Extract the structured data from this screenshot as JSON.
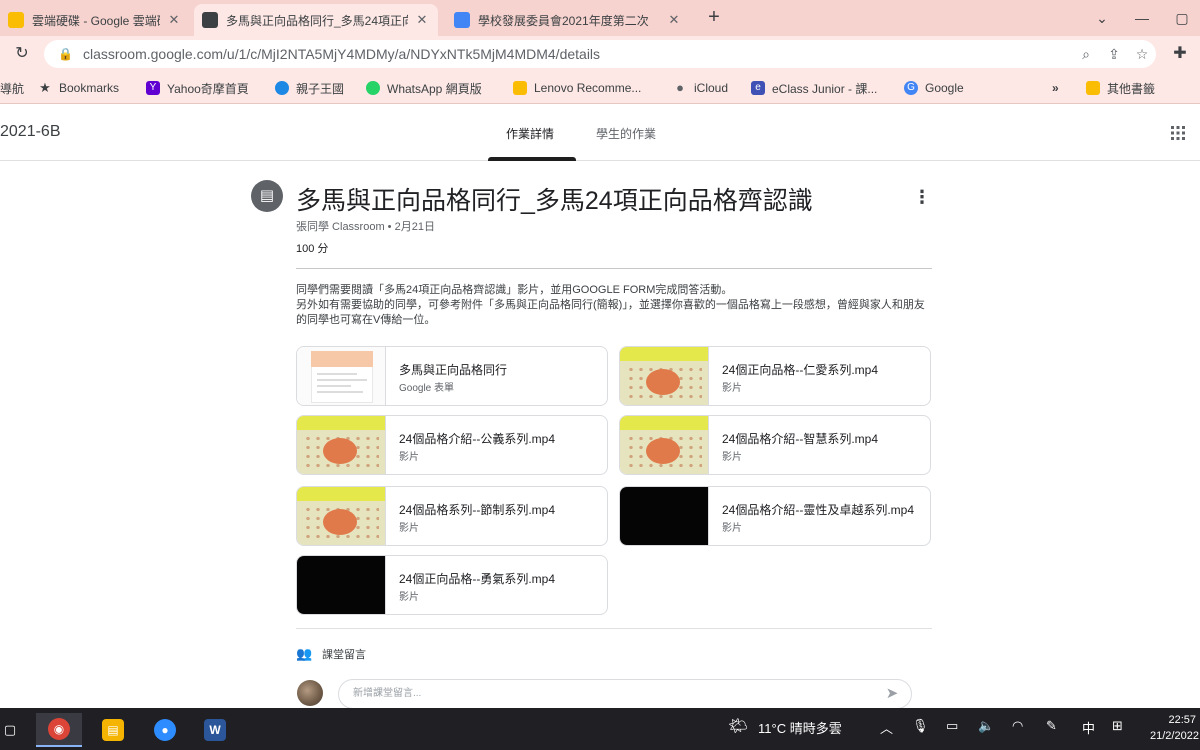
{
  "browser": {
    "tabs": [
      {
        "title": "雲端硬碟 - Google 雲端硬碟",
        "active": false,
        "favicon_color": "#fbbc04"
      },
      {
        "title": "多馬與正向品格同行_多馬24項正向",
        "active": true,
        "favicon_color": "#3c4043"
      },
      {
        "title": "學校發展委員會2021年度第二次",
        "active": false,
        "favicon_color": "#4285f4"
      }
    ],
    "new_tab": "+",
    "url": "classroom.google.com/u/1/c/MjI2NTA5MjY4MDMy/a/NDYxNTk5MjM4MDM4/details",
    "bookmarks": [
      {
        "label": "導航",
        "icon_color": "#9aa0a6"
      },
      {
        "label": "Bookmarks",
        "icon_color": "#3c4043"
      },
      {
        "label": "Yahoo奇摩首頁",
        "icon_color": "#6001d2"
      },
      {
        "label": "親子王國",
        "icon_color": "#1e88e5"
      },
      {
        "label": "WhatsApp 網頁版",
        "icon_color": "#25d366"
      },
      {
        "label": "Lenovo Recomme...",
        "icon_color": "#fbbc04"
      },
      {
        "label": "iCloud",
        "icon_color": "#5f6368"
      },
      {
        "label": "eClass Junior - 課...",
        "icon_color": "#3f51b5"
      },
      {
        "label": "Google",
        "icon_color": "#4285f4"
      },
      {
        "label": "其他書籤",
        "icon_color": "#fbbc04"
      }
    ]
  },
  "classroom": {
    "class_name": "2021-6B",
    "tabs": [
      {
        "label": "作業詳情",
        "active": true
      },
      {
        "label": "學生的作業",
        "active": false
      }
    ]
  },
  "assignment": {
    "title": "多馬與正向品格同行_多馬24項正向品格齊認識",
    "meta": "張同學 Classroom • 2月21日",
    "points": "100 分",
    "description": [
      "同學們需要閱讀「多馬24項正向品格齊認識」影片，並用GOOGLE FORM完成問答活動。",
      "另外如有需要協助的同學，可參考附件「多馬與正向品格同行(簡報)」，並選擇你喜歡的一個品格寫上一段感想，曾經與家人和朋友的同學也可寫在V傳給一位。"
    ],
    "attachments": [
      {
        "title": "多馬與正向品格同行",
        "type": "Google 表單",
        "thumb": "form"
      },
      {
        "title": "24個正向品格--仁愛系列.mp4",
        "type": "影片",
        "thumb": "video"
      },
      {
        "title": "24個品格介紹--公義系列.mp4",
        "type": "影片",
        "thumb": "video"
      },
      {
        "title": "24個品格介紹--智慧系列.mp4",
        "type": "影片",
        "thumb": "video"
      },
      {
        "title": "24個品格系列--節制系列.mp4",
        "type": "影片",
        "thumb": "video"
      },
      {
        "title": "24個品格介紹--靈性及卓越系列.mp4",
        "type": "影片",
        "thumb": "black"
      },
      {
        "title": "24個正向品格--勇氣系列.mp4",
        "type": "影片",
        "thumb": "black"
      }
    ],
    "class_comments_label": "課堂留言",
    "comment_placeholder": "新增課堂留言..."
  },
  "taskbar": {
    "apps": [
      {
        "name": "chrome",
        "glyph": "◉",
        "color": "#db4437",
        "active": true
      },
      {
        "name": "file-explorer",
        "glyph": "▤",
        "color": "#f4b400",
        "active": false
      },
      {
        "name": "zoom",
        "glyph": "●",
        "color": "#2d8cff",
        "active": false
      },
      {
        "name": "word",
        "glyph": "W",
        "color": "#2b579a",
        "active": false
      }
    ],
    "weather": "11°C 晴時多雲",
    "ime": "中",
    "time": "22:57",
    "date": "21/2/2022"
  }
}
